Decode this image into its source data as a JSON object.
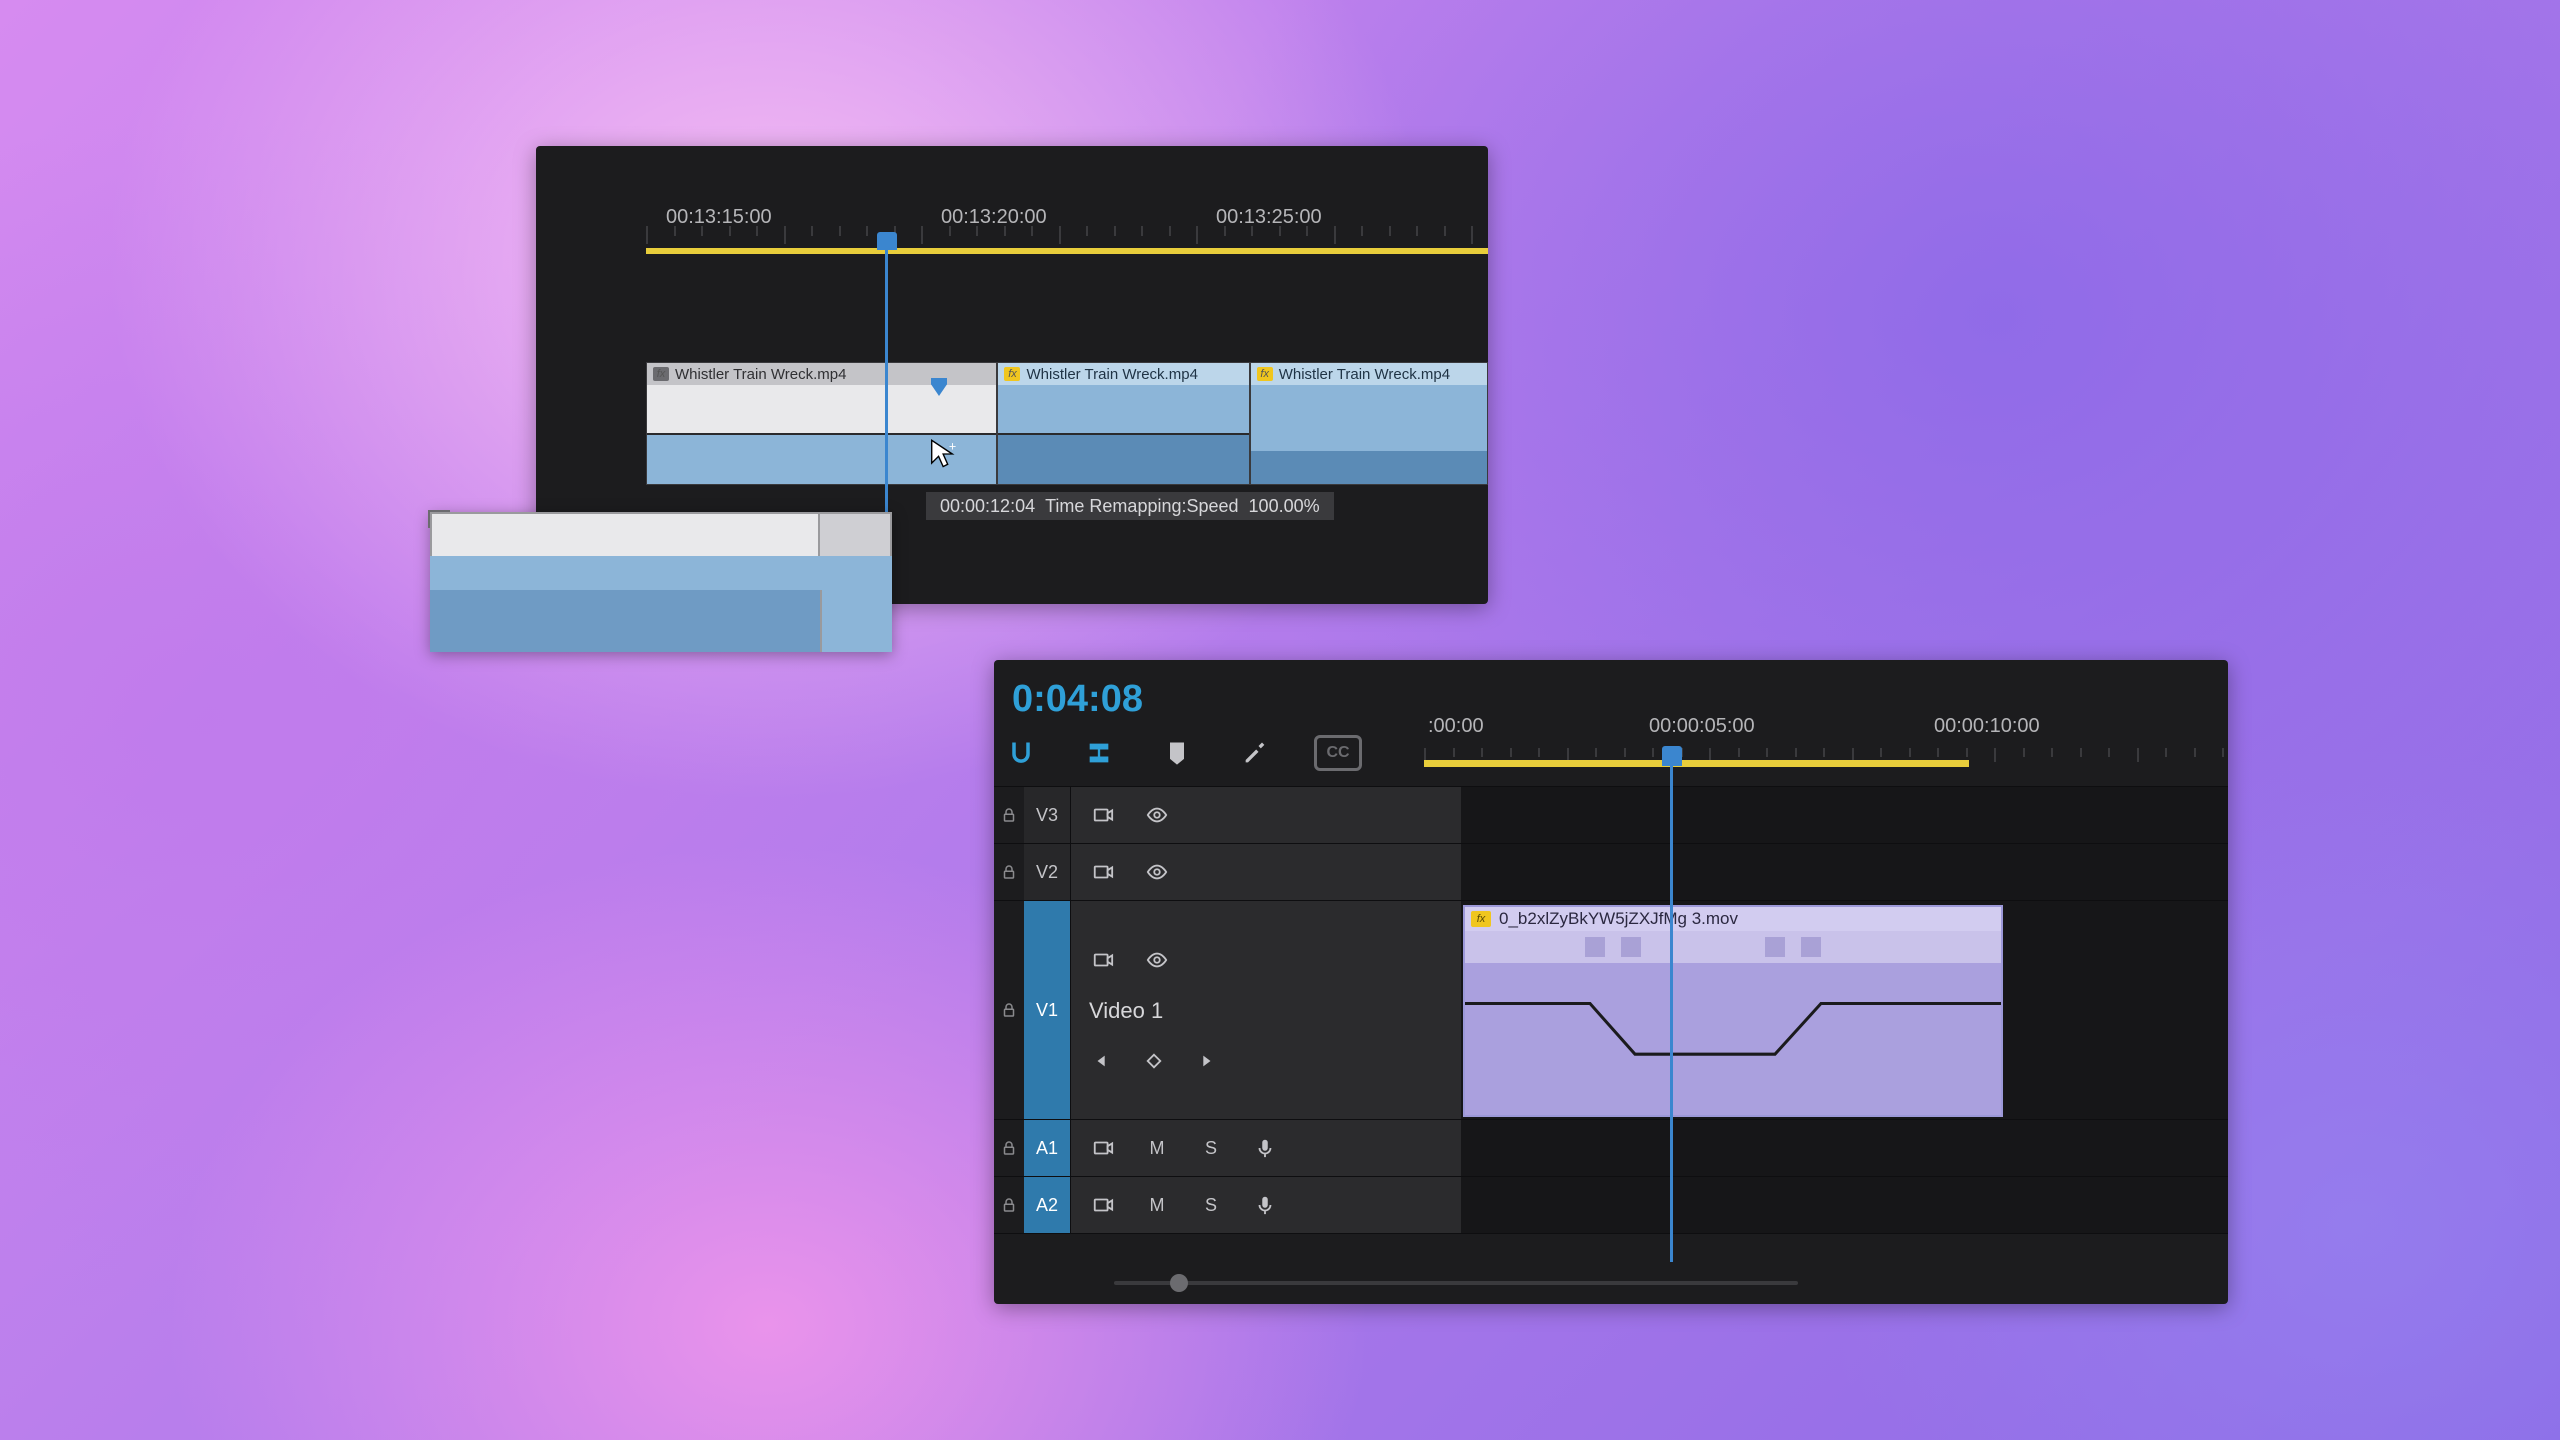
{
  "panelA": {
    "ruler": [
      "00:13:15:00",
      "00:13:20:00",
      "00:13:25:00"
    ],
    "clips": [
      {
        "label": "Whistler Train Wreck.mp4",
        "style": "gray"
      },
      {
        "label": "Whistler Train Wreck.mp4",
        "style": "blue"
      },
      {
        "label": "Whistler Train Wreck.mp4",
        "style": "blue"
      }
    ],
    "tooltip": {
      "time": "00:00:12:04",
      "label": "Time Remapping:Speed",
      "value": "100.00%"
    }
  },
  "panelB": {
    "timecode": "0:04:08",
    "ruler": [
      ":00:00",
      "00:00:05:00",
      "00:00:10:00"
    ],
    "tracks": {
      "v3": "V3",
      "v2": "V2",
      "v1": "V1",
      "v1name": "Video 1",
      "a1": "A1",
      "a2": "A2",
      "mute": "M",
      "solo": "S"
    },
    "clip": {
      "label": "0_b2xlZyBkYW5jZXJfMg 3.mov"
    },
    "cc": "CC"
  }
}
